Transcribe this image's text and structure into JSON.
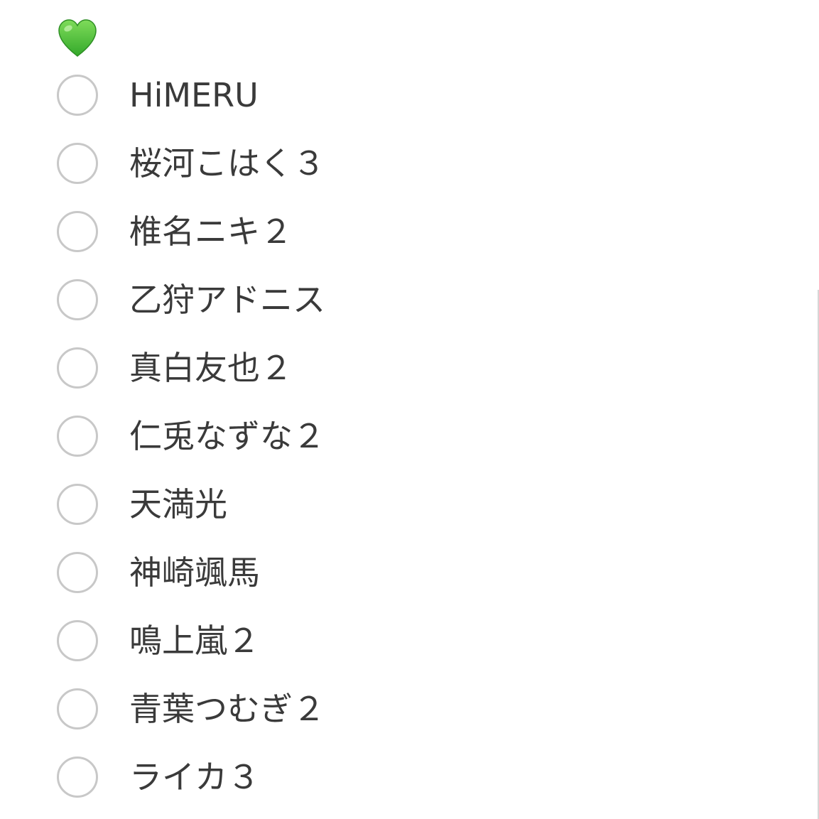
{
  "header": {
    "icon": "green-heart-icon",
    "icon_color": "#4fbf3a"
  },
  "checklist": {
    "items": [
      {
        "label": "HiMERU",
        "checked": false
      },
      {
        "label": "桜河こはく３",
        "checked": false
      },
      {
        "label": "椎名ニキ２",
        "checked": false
      },
      {
        "label": "乙狩アドニス",
        "checked": false
      },
      {
        "label": "真白友也２",
        "checked": false
      },
      {
        "label": "仁兎なずな２",
        "checked": false
      },
      {
        "label": "天満光",
        "checked": false
      },
      {
        "label": "神崎颯馬",
        "checked": false
      },
      {
        "label": "鳴上嵐２",
        "checked": false
      },
      {
        "label": "青葉つむぎ２",
        "checked": false
      },
      {
        "label": "ライカ３",
        "checked": false
      }
    ],
    "radio_border_color": "#c8c8c8",
    "text_color": "#3a3a3a"
  }
}
